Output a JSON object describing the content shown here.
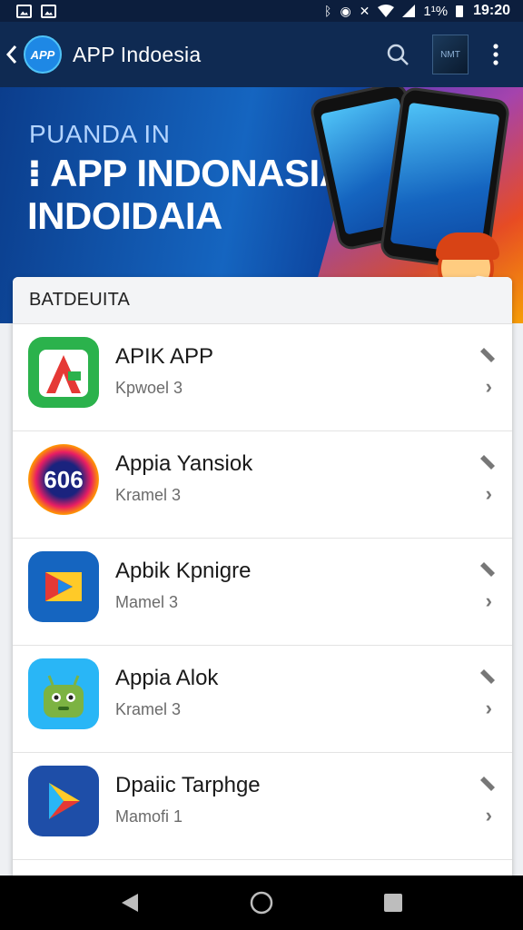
{
  "status_bar": {
    "time": "19:20",
    "battery": "1¹%"
  },
  "app_bar": {
    "logo_text": "APP",
    "title": "APP Indoesia",
    "thumb_text": "NMT"
  },
  "banner": {
    "subtitle": "PUANDA IN",
    "title_line1": "⁝ APP INDONASIA",
    "title_line2": "INDOIDAIA"
  },
  "section": {
    "header": "BATDEUITA"
  },
  "apps": [
    {
      "title": "APIK APP",
      "subtitle": "Kpwoel 3",
      "icon": "red-a-icon"
    },
    {
      "title": "Appia Yansiok",
      "subtitle": "Kramel 3",
      "icon": "606-icon",
      "icon_text": "606"
    },
    {
      "title": "Apbik Kpnigre",
      "subtitle": "Mamel 3",
      "icon": "play-arrow-icon"
    },
    {
      "title": "Appia Alok",
      "subtitle": "Kramel 3",
      "icon": "android-icon"
    },
    {
      "title": "Dpaiic Tarphge",
      "subtitle": "Mamofi 1",
      "icon": "play-triangle-icon"
    }
  ],
  "colors": {
    "app_bar": "#0f2a52",
    "status_bar": "#0c1e3d",
    "banner_blue": "#1565c0",
    "accent_red": "#c62828"
  }
}
